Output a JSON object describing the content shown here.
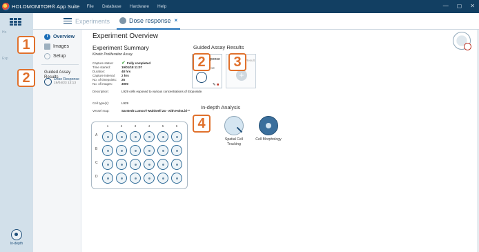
{
  "titlebar": {
    "app_title": "HOLOMONITOR® App Suite",
    "menu": [
      "File",
      "Database",
      "Hardware",
      "Help"
    ],
    "window_buttons": [
      "—",
      "▢",
      "✕"
    ]
  },
  "app_sidebar": {
    "ghost_labels": [
      "Ho",
      "Exp"
    ],
    "indepth_label": "In-depth"
  },
  "tabs": {
    "experiments": "Experiments",
    "active": "Dose response",
    "close": "×"
  },
  "nav": {
    "overview": "Overview",
    "images": "Images",
    "setup": "Setup",
    "guided_title": "Guided Assay Results",
    "guided_item_title": "Dose Response",
    "guided_item_date": "19/04/23 13:13"
  },
  "main": {
    "page_title": "Experiment Overview",
    "summary_title": "Experiment Summary",
    "summary_subtitle": "Kinetic Proliferation Assay",
    "summary": [
      {
        "k": "Capture status:",
        "v": "Fully completed"
      },
      {
        "k": "Time started:",
        "v": "19/01/18 11:07"
      },
      {
        "k": "Duration:",
        "v": "48 hrs"
      },
      {
        "k": "Capture interval:",
        "v": "2 hrs"
      },
      {
        "k": "No. of timepoints:",
        "v": "25"
      },
      {
        "k": "No. of images:",
        "v": "3000"
      },
      {
        "k": "Description:",
        "v": "L929 cells exposed to various concentrations of Etoposide."
      },
      {
        "k": "Cell type(s):",
        "v": "L929"
      },
      {
        "k": "Vessel map:",
        "v": "Sarstedt Lumox® Multiwell 24 - with HoloLid™"
      }
    ],
    "plate": {
      "cols": [
        "1",
        "2",
        "3",
        "4",
        "5",
        "6"
      ],
      "rows": [
        "A",
        "B",
        "C",
        "D"
      ]
    },
    "guided_title": "Guided Assay Results",
    "guided_card": {
      "title": "Dose Response",
      "date": "19/04/23 13:13"
    },
    "new_result_label": "Create New Result",
    "indepth_title": "In-depth Analysis",
    "indepth_items": [
      {
        "label": "Spatial Cell Tracking"
      },
      {
        "label": "Cell Morphology"
      }
    ]
  },
  "callouts": [
    "1",
    "2",
    "2",
    "3",
    "4"
  ]
}
